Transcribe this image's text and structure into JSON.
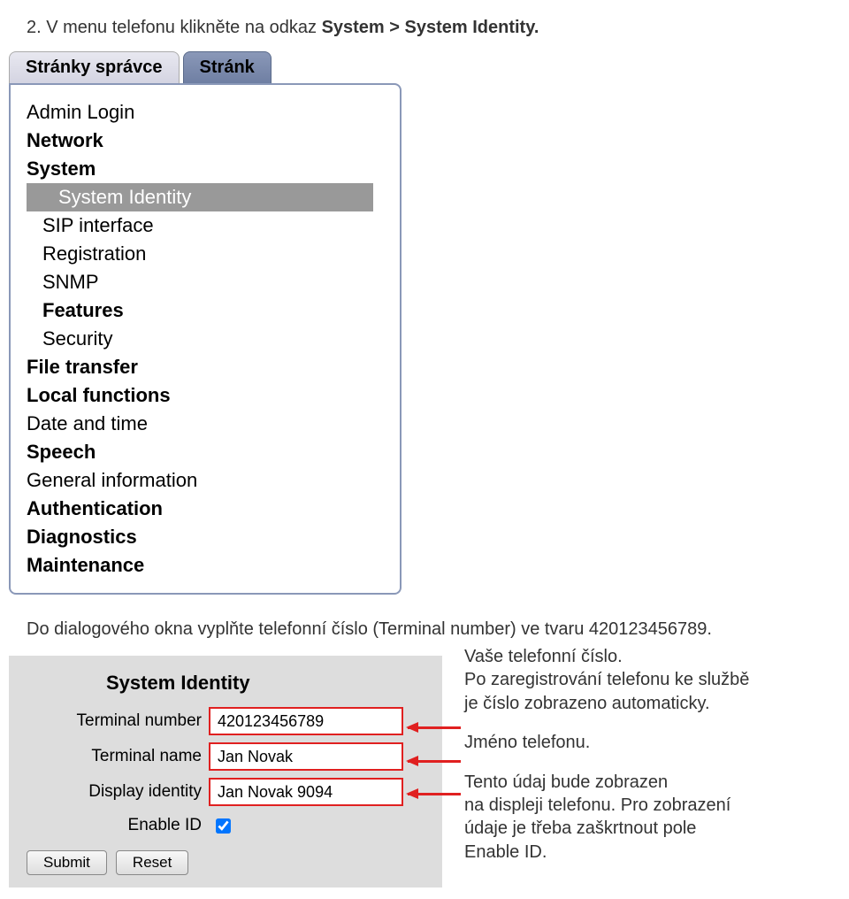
{
  "instruction": {
    "step": "2.",
    "text1": " V menu telefonu klikněte na odkaz ",
    "bold": "System > System Identity."
  },
  "tabs": {
    "active": "Stránky správce",
    "inactive": "Stránk"
  },
  "menu": {
    "items": [
      {
        "label": "Admin Login",
        "bold": false,
        "indent": false,
        "selected": false
      },
      {
        "label": "Network",
        "bold": true,
        "indent": false,
        "selected": false
      },
      {
        "label": "System",
        "bold": true,
        "indent": false,
        "selected": false
      },
      {
        "label": "System Identity",
        "bold": false,
        "indent": true,
        "selected": true
      },
      {
        "label": "SIP interface",
        "bold": false,
        "indent": true,
        "selected": false
      },
      {
        "label": "Registration",
        "bold": false,
        "indent": true,
        "selected": false
      },
      {
        "label": "SNMP",
        "bold": false,
        "indent": true,
        "selected": false
      },
      {
        "label": "Features",
        "bold": true,
        "indent": true,
        "selected": false
      },
      {
        "label": "Security",
        "bold": false,
        "indent": true,
        "selected": false
      },
      {
        "label": "File transfer",
        "bold": true,
        "indent": false,
        "selected": false
      },
      {
        "label": "Local functions",
        "bold": true,
        "indent": false,
        "selected": false
      },
      {
        "label": "Date and time",
        "bold": false,
        "indent": false,
        "selected": false
      },
      {
        "label": "Speech",
        "bold": true,
        "indent": false,
        "selected": false
      },
      {
        "label": "General information",
        "bold": false,
        "indent": false,
        "selected": false
      },
      {
        "label": "Authentication",
        "bold": true,
        "indent": false,
        "selected": false
      },
      {
        "label": "Diagnostics",
        "bold": true,
        "indent": false,
        "selected": false
      },
      {
        "label": "Maintenance",
        "bold": true,
        "indent": false,
        "selected": false
      }
    ]
  },
  "instruction2": "Do dialogového okna vyplňte telefonní číslo (Terminal number) ve tvaru 420123456789.",
  "form": {
    "header": "System Identity",
    "rows": {
      "terminal_number": {
        "label": "Terminal number",
        "value": "420123456789"
      },
      "terminal_name": {
        "label": "Terminal name",
        "value": "Jan Novak"
      },
      "display_identity": {
        "label": "Display identity",
        "value": "Jan Novak 9094"
      },
      "enable_id": {
        "label": "Enable ID",
        "checked": true
      }
    },
    "buttons": {
      "submit": "Submit",
      "reset": "Reset"
    }
  },
  "annotations": {
    "a1_line1": "Vaše telefonní číslo.",
    "a1_line2": "Po zaregistrování telefonu ke službě",
    "a1_line3": "je číslo zobrazeno automaticky.",
    "a2": "Jméno telefonu.",
    "a3_line1": "Tento údaj bude zobrazen",
    "a3_line2": "na displeji telefonu. Pro zobrazení",
    "a3_line3": "údaje je třeba zaškrtnout pole",
    "a3_line4": "Enable ID."
  }
}
